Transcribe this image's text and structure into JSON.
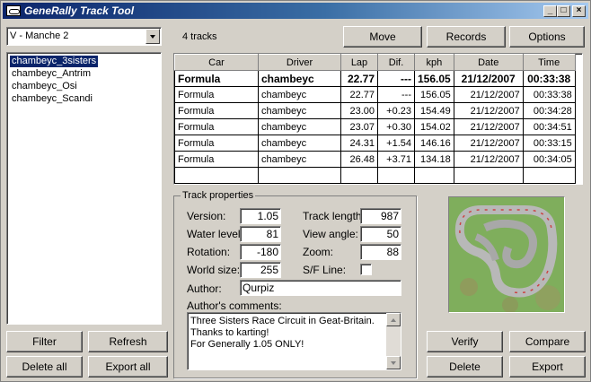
{
  "window": {
    "title": "GeneRally Track Tool"
  },
  "titlebar_buttons": {
    "minimize": "_",
    "maximize": "□",
    "close": "×"
  },
  "season_select": {
    "value": "V - Manche 2"
  },
  "tracks": {
    "selected_index": 0,
    "items": [
      "chambeyc_3sisters",
      "chambeyc_Antrim",
      "chambeyc_Osi",
      "chambeyc_Scandi"
    ]
  },
  "track_count": "4 tracks",
  "toolbar": {
    "move": "Move",
    "records": "Records",
    "options": "Options"
  },
  "records_table": {
    "columns": [
      "Car",
      "Driver",
      "Lap",
      "Dif.",
      "kph",
      "Date",
      "Time"
    ],
    "best": [
      "Formula",
      "chambeyc",
      "22.77",
      "---",
      "156.05",
      "21/12/2007",
      "00:33:38"
    ],
    "rows": [
      [
        "Formula",
        "chambeyc",
        "22.77",
        "---",
        "156.05",
        "21/12/2007",
        "00:33:38"
      ],
      [
        "Formula",
        "chambeyc",
        "23.00",
        "+0.23",
        "154.49",
        "21/12/2007",
        "00:34:28"
      ],
      [
        "Formula",
        "chambeyc",
        "23.07",
        "+0.30",
        "154.02",
        "21/12/2007",
        "00:34:51"
      ],
      [
        "Formula",
        "chambeyc",
        "24.31",
        "+1.54",
        "146.16",
        "21/12/2007",
        "00:33:15"
      ],
      [
        "Formula",
        "chambeyc",
        "26.48",
        "+3.71",
        "134.18",
        "21/12/2007",
        "00:34:05"
      ]
    ]
  },
  "track_properties": {
    "group_label": "Track properties",
    "version_label": "Version:",
    "version": "1.05",
    "water_label": "Water level:",
    "water": "81",
    "rotation_label": "Rotation:",
    "rotation": "-180",
    "world_label": "World size:",
    "world": "255",
    "length_label": "Track length:",
    "length": "987",
    "view_label": "View angle:",
    "view": "50",
    "zoom_label": "Zoom:",
    "zoom": "88",
    "sf_label": "S/F Line:",
    "sf_checked": false,
    "author_label": "Author:",
    "author": "Qurpiz",
    "comments_label": "Author's comments:",
    "comments": [
      "Three Sisters Race Circuit in Geat-Britain.",
      "Thanks to karting!",
      "For Generally 1.05 ONLY!"
    ]
  },
  "buttons": {
    "filter": "Filter",
    "refresh": "Refresh",
    "delete_all": "Delete all",
    "export_all": "Export all",
    "verify": "Verify",
    "compare": "Compare",
    "delete": "Delete",
    "export": "Export"
  }
}
